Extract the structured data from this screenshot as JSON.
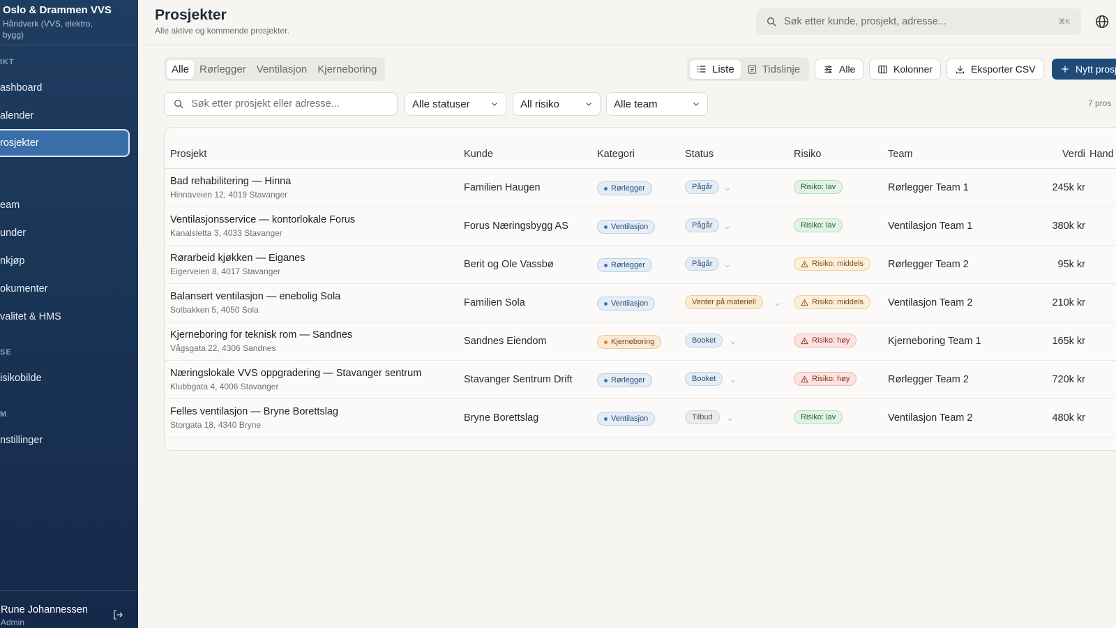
{
  "sidebar": {
    "brand_name": "Oslo & Drammen VVS",
    "brand_sub": "Håndverk (VVS, elektro, bygg)",
    "section_overview": "IKT",
    "items_top": [
      "ashboard",
      "alender",
      "rosjekter"
    ],
    "items_mid": [
      "eam",
      "under",
      "nkjøp",
      "okumenter",
      "valitet & HMS"
    ],
    "section_analysis": "SE",
    "items_analysis": [
      "isikobilde"
    ],
    "section_system": "M",
    "items_system": [
      "nstillinger"
    ],
    "user_name": "Rune Johannessen",
    "user_role": "Admin"
  },
  "header": {
    "title": "Prosjekter",
    "subtitle": "Alle aktive og kommende prosjekter.",
    "search_placeholder": "Søk etter kunde, prosjekt, adresse...",
    "search_shortcut": "⌘K"
  },
  "toolbar": {
    "tabs": [
      "Alle",
      "Rørlegger",
      "Ventilasjon",
      "Kjerneboring"
    ],
    "active_tab": "Alle",
    "view_list": "Liste",
    "view_timeline": "Tidslinje",
    "filter_button": "Alle",
    "columns_button": "Kolonner",
    "export_button": "Eksporter CSV",
    "new_button": "Nytt prosj"
  },
  "filters": {
    "search_placeholder": "Søk etter prosjekt eller adresse...",
    "status": "Alle statuser",
    "risk": "All risiko",
    "team": "Alle team",
    "count": "7 pros"
  },
  "table": {
    "headers": [
      "Prosjekt",
      "Kunde",
      "Kategori",
      "Status",
      "Risiko",
      "Team",
      "Verdi",
      "Hand"
    ],
    "rows": [
      {
        "name": "Bad rehabilitering — Hinna",
        "address": "Hinnaveien 12, 4019 Stavanger",
        "kunde": "Familien Haugen",
        "kategori": "Rørlegger",
        "status": "Pågår",
        "risiko": "Risiko: lav",
        "team": "Rørlegger Team 1",
        "verdi": "245k kr"
      },
      {
        "name": "Ventilasjonsservice — kontorlokale Forus",
        "address": "Kanalsletta 3, 4033 Stavanger",
        "kunde": "Forus Næringsbygg AS",
        "kategori": "Ventilasjon",
        "status": "Pågår",
        "risiko": "Risiko: lav",
        "team": "Ventilasjon Team 1",
        "verdi": "380k kr"
      },
      {
        "name": "Rørarbeid kjøkken — Eiganes",
        "address": "Eigerveien 8, 4017 Stavanger",
        "kunde": "Berit og Ole Vassbø",
        "kategori": "Rørlegger",
        "status": "Pågår",
        "risiko": "Risiko: middels",
        "team": "Rørlegger Team 2",
        "verdi": "95k kr"
      },
      {
        "name": "Balansert ventilasjon — enebolig Sola",
        "address": "Solbakken 5, 4050 Sola",
        "kunde": "Familien Sola",
        "kategori": "Ventilasjon",
        "status": "Venter på materiell",
        "risiko": "Risiko: middels",
        "team": "Ventilasjon Team 2",
        "verdi": "210k kr"
      },
      {
        "name": "Kjerneboring for teknisk rom — Sandnes",
        "address": "Vågsgata 22, 4306 Sandnes",
        "kunde": "Sandnes Eiendom",
        "kategori": "Kjerneboring",
        "status": "Booket",
        "risiko": "Risiko: høy",
        "team": "Kjerneboring Team 1",
        "verdi": "165k kr"
      },
      {
        "name": "Næringslokale VVS oppgradering — Stavanger sentrum",
        "address": "Klubbgata 4, 4006 Stavanger",
        "kunde": "Stavanger Sentrum Drift",
        "kategori": "Rørlegger",
        "status": "Booket",
        "risiko": "Risiko: høy",
        "team": "Rørlegger Team 2",
        "verdi": "720k kr"
      },
      {
        "name": "Felles ventilasjon — Bryne Borettslag",
        "address": "Storgata 18, 4340 Bryne",
        "kunde": "Bryne Borettslag",
        "kategori": "Ventilasjon",
        "status": "Tilbud",
        "risiko": "Risiko: lav",
        "team": "Ventilasjon Team 2",
        "verdi": "480k kr"
      }
    ]
  },
  "colors": {
    "sidebar_bg": "#1f3d61",
    "accent": "#1f4b7a",
    "active_nav": "#3a6ea8"
  }
}
